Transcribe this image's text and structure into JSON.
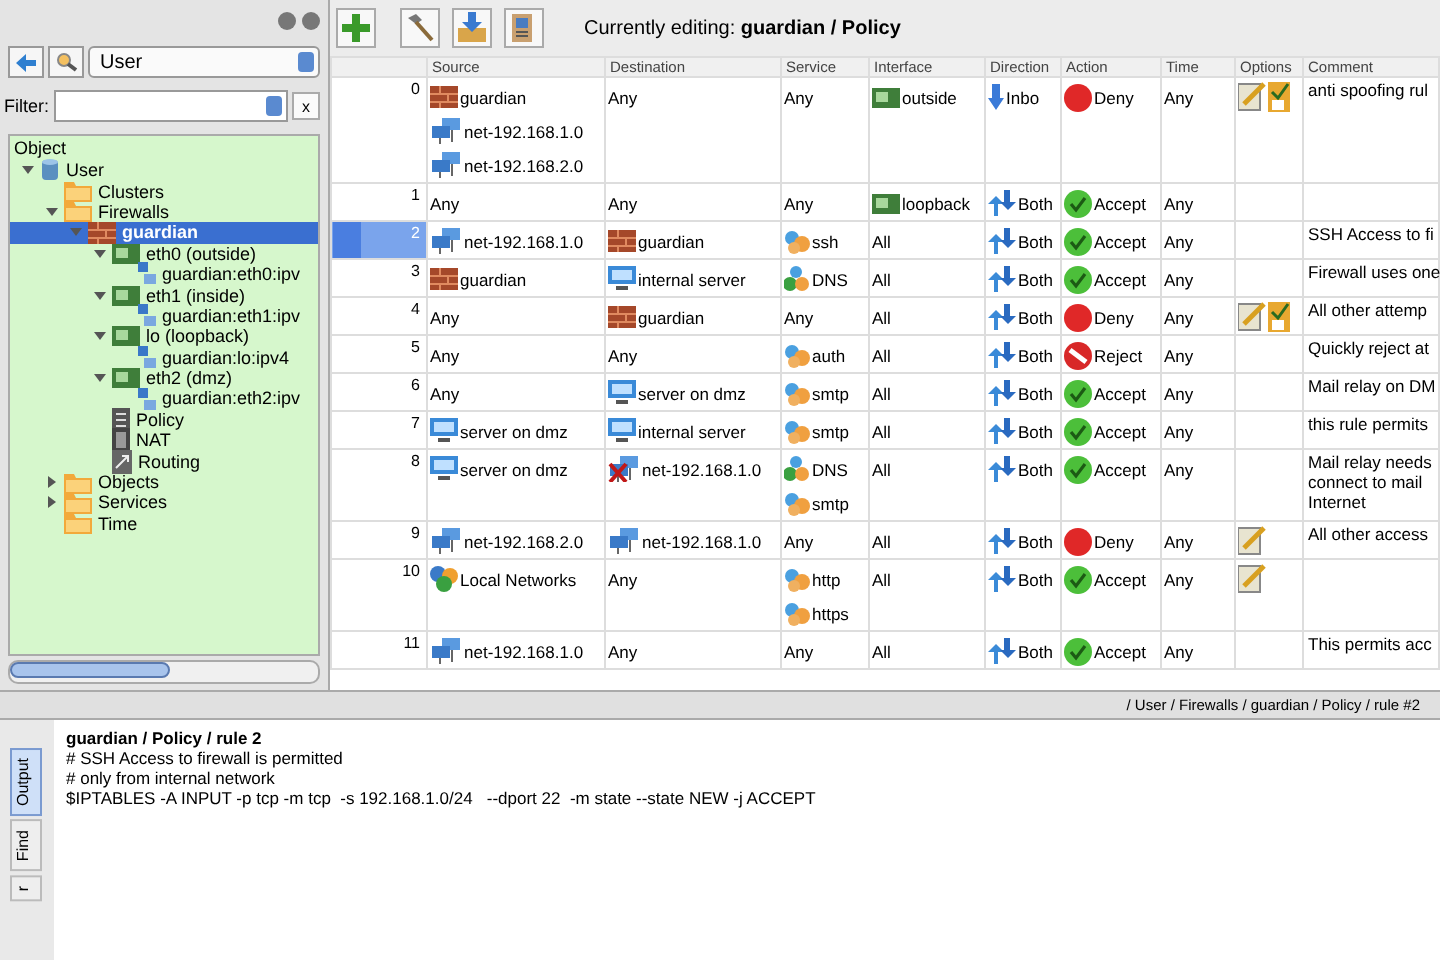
{
  "left_panel": {
    "location": "User",
    "filter": {
      "label": "Filter:",
      "clear_label": "x"
    },
    "tree_header": "Object",
    "tree": [
      {
        "label": "User",
        "kind": "library",
        "expanded": true,
        "selected": false,
        "children": [
          {
            "label": "Clusters",
            "kind": "folder",
            "selected": false
          },
          {
            "label": "Firewalls",
            "kind": "folder",
            "expanded": true,
            "selected": false,
            "children": [
              {
                "label": "guardian",
                "kind": "firewall",
                "expanded": true,
                "selected": true,
                "children": [
                  {
                    "label": "eth0 (outside)",
                    "kind": "interface",
                    "expanded": true,
                    "selected": false,
                    "children": [
                      {
                        "label": "guardian:eth0:ipv",
                        "kind": "address",
                        "selected": false
                      }
                    ]
                  },
                  {
                    "label": "eth1 (inside)",
                    "kind": "interface",
                    "expanded": true,
                    "selected": false,
                    "children": [
                      {
                        "label": "guardian:eth1:ipv",
                        "kind": "address",
                        "selected": false
                      }
                    ]
                  },
                  {
                    "label": "lo (loopback)",
                    "kind": "interface",
                    "expanded": true,
                    "selected": false,
                    "children": [
                      {
                        "label": "guardian:lo:ipv4",
                        "kind": "address",
                        "selected": false
                      }
                    ]
                  },
                  {
                    "label": "eth2 (dmz)",
                    "kind": "interface",
                    "expanded": true,
                    "selected": false,
                    "children": [
                      {
                        "label": "guardian:eth2:ipv",
                        "kind": "address",
                        "selected": false
                      }
                    ]
                  },
                  {
                    "label": "Policy",
                    "kind": "policy",
                    "selected": false
                  },
                  {
                    "label": "NAT",
                    "kind": "nat",
                    "selected": false
                  },
                  {
                    "label": "Routing",
                    "kind": "routing",
                    "selected": false
                  }
                ]
              }
            ]
          },
          {
            "label": "Objects",
            "kind": "folder",
            "expanded": false,
            "selected": false
          },
          {
            "label": "Services",
            "kind": "folder",
            "expanded": false,
            "selected": false
          },
          {
            "label": "Time",
            "kind": "folder",
            "selected": false
          }
        ]
      }
    ]
  },
  "editing": "Currently editing: **guardian / Policy**",
  "columns": [
    "Source",
    "Destination",
    "Service",
    "Interface",
    "Direction",
    "Action",
    "Time",
    "Options",
    "Comment"
  ],
  "rows": [
    {
      "num": "0",
      "selected": false,
      "source": [
        {
          "kind": "firewall",
          "text": "guardian"
        },
        {
          "kind": "network",
          "text": "net-192.168.1.0"
        },
        {
          "kind": "network",
          "text": "net-192.168.2.0"
        }
      ],
      "destination": [
        {
          "kind": "any",
          "text": "Any"
        }
      ],
      "service": [
        {
          "kind": "any",
          "text": "Any"
        }
      ],
      "interface": [
        {
          "kind": "interface",
          "text": "outside"
        }
      ],
      "direction": {
        "kind": "inbound",
        "text": "Inbo"
      },
      "action": {
        "kind": "deny",
        "text": "Deny"
      },
      "time": "Any",
      "logging": true,
      "options": true,
      "comment": [
        "anti spoofing rul"
      ]
    },
    {
      "num": "1",
      "selected": false,
      "source": [
        {
          "kind": "any",
          "text": "Any"
        }
      ],
      "destination": [
        {
          "kind": "any",
          "text": "Any"
        }
      ],
      "service": [
        {
          "kind": "any",
          "text": "Any"
        }
      ],
      "interface": [
        {
          "kind": "interface",
          "text": "loopback"
        }
      ],
      "direction": {
        "kind": "both",
        "text": "Both"
      },
      "action": {
        "kind": "accept",
        "text": "Accept"
      },
      "time": "Any",
      "logging": false,
      "options": false,
      "comment": []
    },
    {
      "num": "2",
      "selected": true,
      "source": [
        {
          "kind": "network",
          "text": "net-192.168.1.0"
        }
      ],
      "destination": [
        {
          "kind": "firewall",
          "text": "guardian"
        }
      ],
      "service": [
        {
          "kind": "tcp",
          "text": "ssh"
        }
      ],
      "interface": [
        {
          "kind": "any",
          "text": "All"
        }
      ],
      "direction": {
        "kind": "both",
        "text": "Both"
      },
      "action": {
        "kind": "accept",
        "text": "Accept"
      },
      "time": "Any",
      "logging": false,
      "options": false,
      "comment": [
        "SSH Access to fi"
      ]
    },
    {
      "num": "3",
      "selected": false,
      "source": [
        {
          "kind": "firewall",
          "text": "guardian"
        }
      ],
      "destination": [
        {
          "kind": "host",
          "text": "internal server"
        }
      ],
      "service": [
        {
          "kind": "dns",
          "text": "DNS"
        }
      ],
      "interface": [
        {
          "kind": "any",
          "text": "All"
        }
      ],
      "direction": {
        "kind": "both",
        "text": "Both"
      },
      "action": {
        "kind": "accept",
        "text": "Accept"
      },
      "time": "Any",
      "logging": false,
      "options": false,
      "comment": [
        "Firewall uses one"
      ]
    },
    {
      "num": "4",
      "selected": false,
      "source": [
        {
          "kind": "any",
          "text": "Any"
        }
      ],
      "destination": [
        {
          "kind": "firewall",
          "text": "guardian"
        }
      ],
      "service": [
        {
          "kind": "any",
          "text": "Any"
        }
      ],
      "interface": [
        {
          "kind": "any",
          "text": "All"
        }
      ],
      "direction": {
        "kind": "both",
        "text": "Both"
      },
      "action": {
        "kind": "deny",
        "text": "Deny"
      },
      "time": "Any",
      "logging": true,
      "options": true,
      "comment": [
        "All other attemp"
      ]
    },
    {
      "num": "5",
      "selected": false,
      "source": [
        {
          "kind": "any",
          "text": "Any"
        }
      ],
      "destination": [
        {
          "kind": "any",
          "text": "Any"
        }
      ],
      "service": [
        {
          "kind": "tcp",
          "text": "auth"
        }
      ],
      "interface": [
        {
          "kind": "any",
          "text": "All"
        }
      ],
      "direction": {
        "kind": "both",
        "text": "Both"
      },
      "action": {
        "kind": "reject",
        "text": "Reject"
      },
      "time": "Any",
      "logging": false,
      "options": false,
      "comment": [
        "Quickly reject at"
      ]
    },
    {
      "num": "6",
      "selected": false,
      "source": [
        {
          "kind": "any",
          "text": "Any"
        }
      ],
      "destination": [
        {
          "kind": "host",
          "text": "server on dmz"
        }
      ],
      "service": [
        {
          "kind": "tcp",
          "text": "smtp"
        }
      ],
      "interface": [
        {
          "kind": "any",
          "text": "All"
        }
      ],
      "direction": {
        "kind": "both",
        "text": "Both"
      },
      "action": {
        "kind": "accept",
        "text": "Accept"
      },
      "time": "Any",
      "logging": false,
      "options": false,
      "comment": [
        "Mail relay on DM"
      ]
    },
    {
      "num": "7",
      "selected": false,
      "source": [
        {
          "kind": "host",
          "text": "server on dmz"
        }
      ],
      "destination": [
        {
          "kind": "host",
          "text": "internal server"
        }
      ],
      "service": [
        {
          "kind": "tcp",
          "text": "smtp"
        }
      ],
      "interface": [
        {
          "kind": "any",
          "text": "All"
        }
      ],
      "direction": {
        "kind": "both",
        "text": "Both"
      },
      "action": {
        "kind": "accept",
        "text": "Accept"
      },
      "time": "Any",
      "logging": false,
      "options": false,
      "comment": [
        "this rule permits"
      ]
    },
    {
      "num": "8",
      "selected": false,
      "source": [
        {
          "kind": "host",
          "text": "server on dmz"
        }
      ],
      "destination": [
        {
          "kind": "network",
          "text": "net-192.168.1.0",
          "negated": true
        }
      ],
      "service": [
        {
          "kind": "dns",
          "text": "DNS"
        },
        {
          "kind": "tcp",
          "text": "smtp"
        }
      ],
      "interface": [
        {
          "kind": "any",
          "text": "All"
        }
      ],
      "direction": {
        "kind": "both",
        "text": "Both"
      },
      "action": {
        "kind": "accept",
        "text": "Accept"
      },
      "time": "Any",
      "logging": false,
      "options": false,
      "comment": [
        "Mail relay needs",
        "connect to mail",
        "Internet"
      ]
    },
    {
      "num": "9",
      "selected": false,
      "source": [
        {
          "kind": "network",
          "text": "net-192.168.2.0"
        }
      ],
      "destination": [
        {
          "kind": "network",
          "text": "net-192.168.1.0"
        }
      ],
      "service": [
        {
          "kind": "any",
          "text": "Any"
        }
      ],
      "interface": [
        {
          "kind": "any",
          "text": "All"
        }
      ],
      "direction": {
        "kind": "both",
        "text": "Both"
      },
      "action": {
        "kind": "deny",
        "text": "Deny"
      },
      "time": "Any",
      "logging": true,
      "options": false,
      "comment": [
        "All other access"
      ]
    },
    {
      "num": "10",
      "selected": false,
      "source": [
        {
          "kind": "group",
          "text": "Local Networks"
        }
      ],
      "destination": [
        {
          "kind": "any",
          "text": "Any"
        }
      ],
      "service": [
        {
          "kind": "tcp",
          "text": "http"
        },
        {
          "kind": "tcp",
          "text": "https"
        }
      ],
      "interface": [
        {
          "kind": "any",
          "text": "All"
        }
      ],
      "direction": {
        "kind": "both",
        "text": "Both"
      },
      "action": {
        "kind": "accept",
        "text": "Accept"
      },
      "time": "Any",
      "logging": true,
      "options": false,
      "comment": []
    },
    {
      "num": "11",
      "selected": false,
      "source": [
        {
          "kind": "network",
          "text": "net-192.168.1.0"
        }
      ],
      "destination": [
        {
          "kind": "any",
          "text": "Any"
        }
      ],
      "service": [
        {
          "kind": "any",
          "text": "Any"
        }
      ],
      "interface": [
        {
          "kind": "any",
          "text": "All"
        }
      ],
      "direction": {
        "kind": "both",
        "text": "Both"
      },
      "action": {
        "kind": "accept",
        "text": "Accept"
      },
      "time": "Any",
      "logging": false,
      "options": false,
      "comment": [
        "This permits acc"
      ]
    }
  ],
  "path_bar": "/ User / Firewalls / guardian / Policy / rule #2",
  "output": {
    "title": "guardian / Policy / rule 2",
    "lines": [
      "# SSH Access to firewall is permitted",
      "# only from internal network",
      "$IPTABLES -A INPUT -p tcp -m tcp  -s 192.168.1.0/24   --dport 22  -m state --state NEW -j ACCEPT"
    ]
  },
  "side_tabs": [
    {
      "label": "Output",
      "selected": true
    },
    {
      "label": "Find",
      "selected": false
    },
    {
      "label": "r",
      "selected": false
    }
  ]
}
